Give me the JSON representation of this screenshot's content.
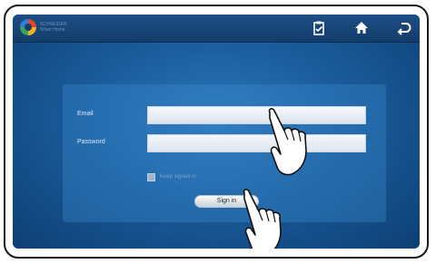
{
  "topbar": {
    "brand_line1": "SCHNEIDER",
    "brand_line2": "Wiser Home",
    "icons": [
      "clipboard-icon",
      "home-icon",
      "back-icon"
    ]
  },
  "login": {
    "email_label": "Email",
    "email_value": "",
    "password_label": "Password",
    "password_value": "",
    "remember_label": "Keep signed in",
    "remember_checked": false,
    "signin_label": "Sign in"
  },
  "colors": {
    "background": "#1a5c9c",
    "topbar": "#143c6a",
    "panel": "#3c8cd2",
    "field": "#e8eef4"
  }
}
